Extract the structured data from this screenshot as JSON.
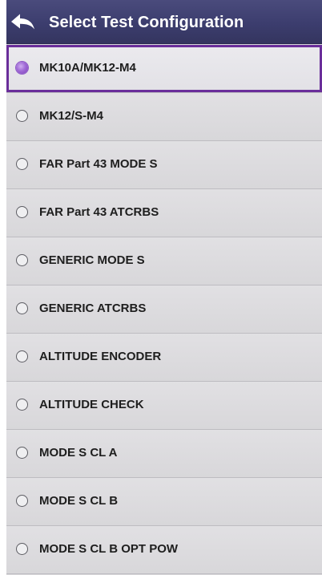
{
  "header": {
    "title": "Select Test Configuration",
    "back_icon": "back-arrow-icon",
    "background_color": "#3e3f70"
  },
  "configurations": [
    {
      "label": "MK10A/MK12-M4",
      "selected": true
    },
    {
      "label": "MK12/S-M4",
      "selected": false
    },
    {
      "label": "FAR Part 43 MODE S",
      "selected": false
    },
    {
      "label": "FAR Part 43 ATCRBS",
      "selected": false
    },
    {
      "label": "GENERIC MODE S",
      "selected": false
    },
    {
      "label": "GENERIC ATCRBS",
      "selected": false
    },
    {
      "label": "ALTITUDE ENCODER",
      "selected": false
    },
    {
      "label": "ALTITUDE CHECK",
      "selected": false
    },
    {
      "label": "MODE S CL A",
      "selected": false
    },
    {
      "label": "MODE S CL B",
      "selected": false
    },
    {
      "label": "MODE S CL B OPT POW",
      "selected": false
    }
  ],
  "colors": {
    "selected_border": "#6a2e9a",
    "selected_radio": "#9a5fd3",
    "list_background": "#d8d8da"
  }
}
